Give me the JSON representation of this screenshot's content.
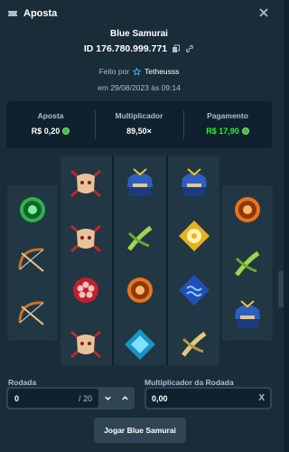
{
  "header": {
    "title": "Aposta",
    "icon": "ticket-icon"
  },
  "game": {
    "name": "Blue Samurai",
    "bet_id": "ID 176.780.999.771"
  },
  "meta": {
    "made_by_prefix": "Feito por",
    "user": "Tetheusss",
    "date": "em 29/08/2023 às 09:14"
  },
  "stats": {
    "bet_label": "Aposta",
    "bet_value": "R$ 0,20",
    "mult_label": "Multiplicador",
    "mult_value": "89,50×",
    "payout_label": "Pagamento",
    "payout_value": "R$ 17,90"
  },
  "reels": {
    "col1": [
      "tomoe-green",
      "bow",
      "bow"
    ],
    "col2": [
      "oni-mask",
      "oni-mask",
      "mon-red",
      "oni-mask"
    ],
    "col3": [
      "samurai-helmet",
      "bamboo-green",
      "tomoe-orange",
      "crest-cyan"
    ],
    "col4": [
      "samurai-helmet",
      "flower-gold",
      "wave-blue",
      "bamboo-gold"
    ],
    "col5": [
      "tomoe-orange",
      "bamboo-green",
      "samurai-helmet"
    ]
  },
  "round": {
    "label": "Rodada",
    "value": "0",
    "total": "/ 20"
  },
  "round_multiplier": {
    "label": "Multiplicador da Rodada",
    "value": "0,00",
    "clear": "X"
  },
  "play_button": "Jogar Blue Samurai",
  "colors": {
    "bg": "#1a2c38",
    "panel": "#0f212e",
    "green": "#1fff20",
    "button": "#2f4553"
  }
}
